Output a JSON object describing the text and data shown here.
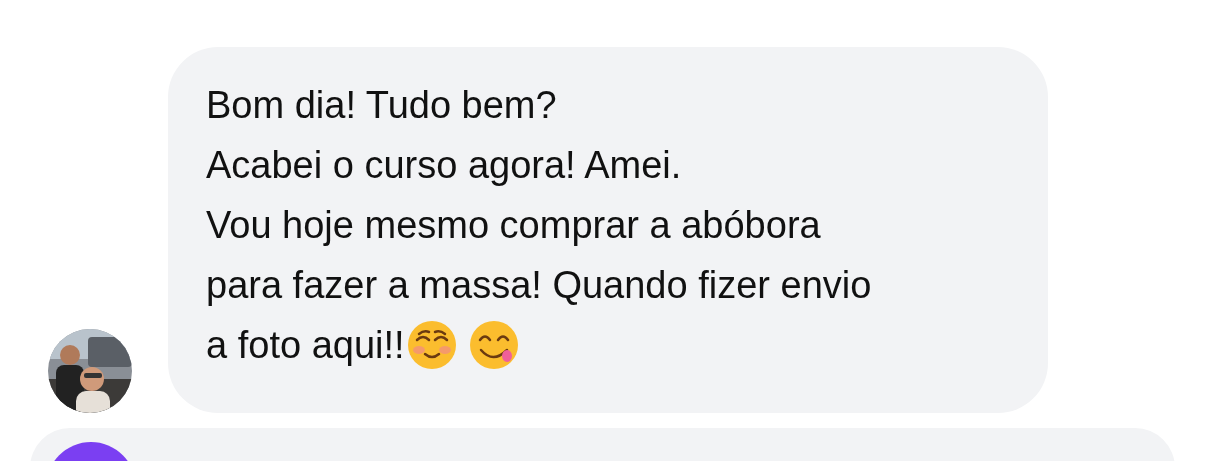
{
  "message": {
    "lines": [
      "Bom dia! Tudo bem?",
      "Acabei o curso agora! Amei.",
      "Vou hoje mesmo comprar a abóbora",
      "para fazer a massa! Quando fizer envio",
      "a foto aqui!!"
    ]
  }
}
